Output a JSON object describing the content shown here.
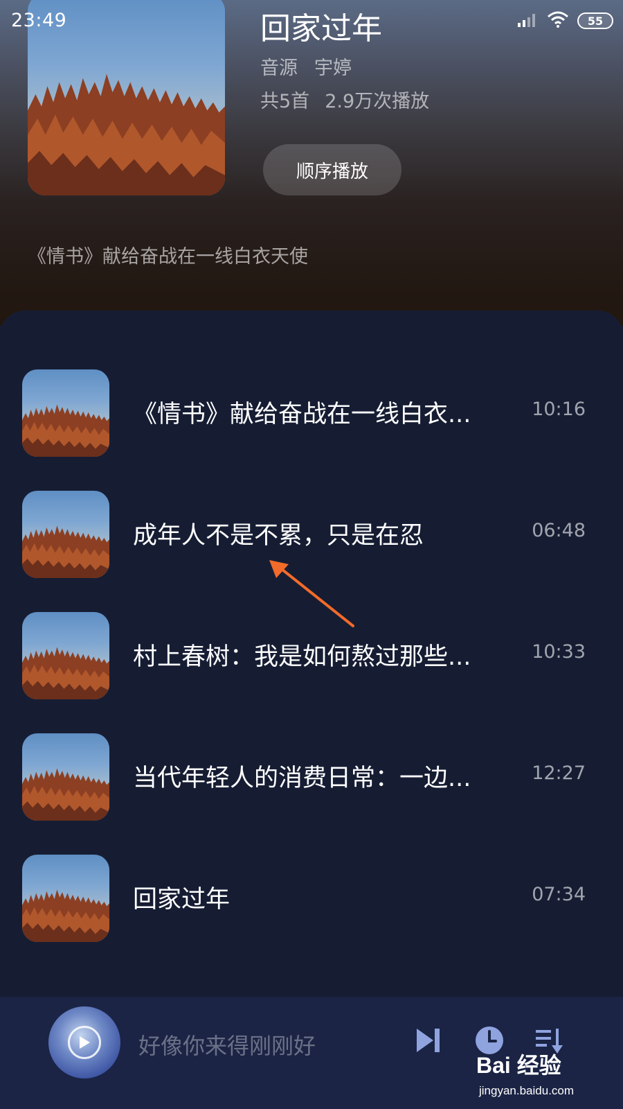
{
  "status_bar": {
    "time": "23:49",
    "battery": "55",
    "icons": [
      "signal-icon",
      "wifi-icon",
      "battery-icon"
    ]
  },
  "album": {
    "title": "回家过年",
    "source_label": "音源",
    "source_name": "宇婷",
    "track_count": "共5首",
    "plays": "2.9万次播放",
    "play_order_label": "顺序播放",
    "description": "《情书》献给奋战在一线白衣天使"
  },
  "tracks": [
    {
      "title": "《情书》献给奋战在一线白衣...",
      "duration": "10:16"
    },
    {
      "title": "成年人不是不累，只是在忍",
      "duration": "06:48"
    },
    {
      "title": "村上春树：我是如何熬过那些...",
      "duration": "10:33"
    },
    {
      "title": "当代年轻人的消费日常：一边...",
      "duration": "12:27"
    },
    {
      "title": "回家过年",
      "duration": "07:34"
    }
  ],
  "player": {
    "now_playing": "好像你来得刚刚好",
    "controls": [
      "next-icon",
      "timer-icon",
      "playlist-icon"
    ]
  },
  "watermark": {
    "text": "Bai 经验",
    "url": "jingyan.baidu.com"
  },
  "colors": {
    "panel_bg": "#161d33",
    "player_bg": "#1b2445",
    "accent_arrow": "#f26b2a"
  }
}
